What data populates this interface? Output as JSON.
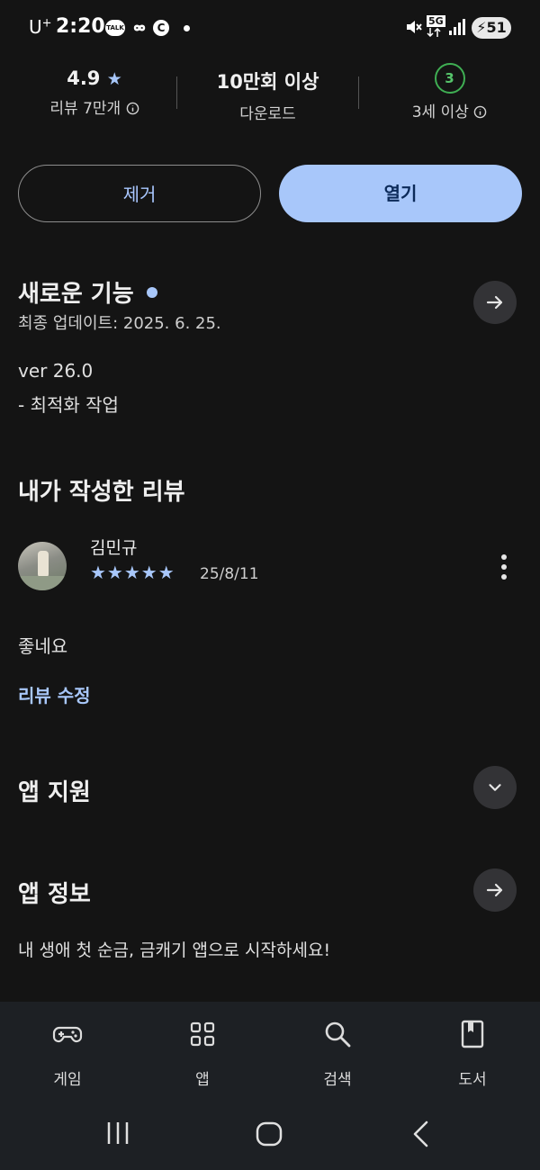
{
  "status": {
    "carrier": "U",
    "carrier_sup": "+",
    "time": "2:20",
    "talk_badge": "TALK",
    "signal_5g": "5G",
    "battery": "51"
  },
  "stats": {
    "rating": "4.9",
    "rating_star": "★",
    "reviews": "리뷰 7만개",
    "downloads": "10만회 이상",
    "downloads_label": "다운로드",
    "age_badge": "3",
    "age_label": "3세 이상"
  },
  "buttons": {
    "remove": "제거",
    "open": "열기"
  },
  "whats_new": {
    "title": "새로운 기능",
    "updated": "최종 업데이트: 2025. 6. 25.",
    "version": "ver 26.0",
    "notes": "- 최적화 작업"
  },
  "my_review": {
    "title": "내가 작성한 리뷰",
    "reviewer": "김민규",
    "stars": "★★★★★",
    "rating": 5,
    "date": "25/8/11",
    "text": "좋네요",
    "edit_link": "리뷰 수정"
  },
  "app_support": {
    "title": "앱 지원"
  },
  "app_info": {
    "title": "앱 정보",
    "description": "내 생애 첫 순금, 금캐기 앱으로 시작하세요!"
  },
  "bottom_nav": [
    {
      "label": "게임",
      "icon": "gamepad-icon"
    },
    {
      "label": "앱",
      "icon": "apps-grid-icon"
    },
    {
      "label": "검색",
      "icon": "search-icon"
    },
    {
      "label": "도서",
      "icon": "book-icon"
    }
  ],
  "colors": {
    "background": "#141414",
    "accent": "#a8c7fa",
    "age_green": "#3fae53"
  }
}
